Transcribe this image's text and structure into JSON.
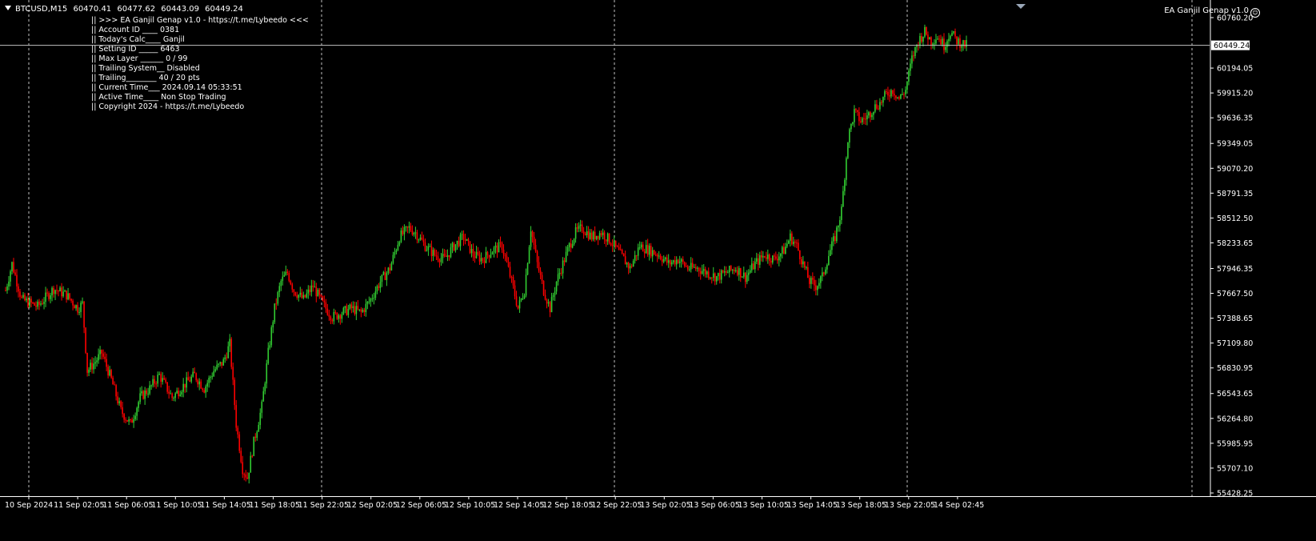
{
  "header": {
    "symbol": "BTCUSD,M15",
    "open": "60470.41",
    "high": "60477.62",
    "low": "60443.09",
    "close": "60449.24"
  },
  "ea_panel": {
    "lines": [
      "|| >>> EA Ganjil Genap v1.0 - https://t.me/Lybeedo <<<",
      "|| Account ID ____ 0381",
      "|| Today's Calc____ Ganjil",
      "|| Setting ID _____ 6463",
      "|| Max Layer ______ 0 / 99",
      "|| Trailing System__ Disabled",
      "|| Trailing________ 40 / 20 pts",
      "|| Current Time___ 2024.09.14 05:33:51",
      "|| Active Time____ Non Stop Trading",
      "|| Copyright 2024 - https://t.me/Lybeedo"
    ]
  },
  "ea_title": "EA Ganjil Genap v1.0",
  "colors": {
    "background": "#000000",
    "bull": "#32CD32",
    "bear": "#FF0000",
    "grid": "#C0C0C0",
    "price_line": "#C0C0C0"
  },
  "chart_data": {
    "type": "candlestick",
    "current_price": "60449.24",
    "y_ticks": [
      "60760.20",
      "60194.05",
      "59915.20",
      "59636.35",
      "59349.05",
      "59070.20",
      "58791.35",
      "58512.50",
      "58233.65",
      "57946.35",
      "57667.50",
      "57388.65",
      "57109.80",
      "56830.95",
      "56543.65",
      "56264.80",
      "55985.95",
      "55707.10",
      "55428.25"
    ],
    "ylim": [
      55428.25,
      60760.2
    ],
    "x_ticks": [
      "10 Sep 2024",
      "11 Sep 02:05",
      "11 Sep 06:05",
      "11 Sep 10:05",
      "11 Sep 14:05",
      "11 Sep 18:05",
      "11 Sep 22:05",
      "12 Sep 02:05",
      "12 Sep 06:05",
      "12 Sep 10:05",
      "12 Sep 14:05",
      "12 Sep 18:05",
      "12 Sep 22:05",
      "13 Sep 02:05",
      "13 Sep 06:05",
      "13 Sep 10:05",
      "13 Sep 14:05",
      "13 Sep 18:05",
      "13 Sep 22:05",
      "14 Sep 02:45"
    ],
    "day_separators": [
      "11 Sep",
      "12 Sep",
      "13 Sep",
      "14 Sep"
    ],
    "keypoints": [
      [
        0,
        57700
      ],
      [
        4,
        58000
      ],
      [
        10,
        57600
      ],
      [
        20,
        57520
      ],
      [
        30,
        57720
      ],
      [
        38,
        57650
      ],
      [
        45,
        57500
      ],
      [
        48,
        57550
      ],
      [
        51,
        56800
      ],
      [
        56,
        56900
      ],
      [
        60,
        57000
      ],
      [
        66,
        56700
      ],
      [
        72,
        56350
      ],
      [
        78,
        56200
      ],
      [
        84,
        56500
      ],
      [
        90,
        56600
      ],
      [
        96,
        56750
      ],
      [
        104,
        56500
      ],
      [
        112,
        56650
      ],
      [
        118,
        56750
      ],
      [
        124,
        56600
      ],
      [
        130,
        56800
      ],
      [
        136,
        56900
      ],
      [
        140,
        57100
      ],
      [
        144,
        56200
      ],
      [
        148,
        55700
      ],
      [
        151,
        55600
      ],
      [
        155,
        56000
      ],
      [
        160,
        56400
      ],
      [
        164,
        57000
      ],
      [
        168,
        57500
      ],
      [
        172,
        57800
      ],
      [
        176,
        57900
      ],
      [
        180,
        57700
      ],
      [
        186,
        57600
      ],
      [
        192,
        57750
      ],
      [
        198,
        57550
      ],
      [
        204,
        57400
      ],
      [
        210,
        57450
      ],
      [
        216,
        57500
      ],
      [
        222,
        57450
      ],
      [
        228,
        57600
      ],
      [
        234,
        57800
      ],
      [
        240,
        57950
      ],
      [
        246,
        58300
      ],
      [
        252,
        58400
      ],
      [
        256,
        58350
      ],
      [
        262,
        58200
      ],
      [
        268,
        58100
      ],
      [
        274,
        58050
      ],
      [
        280,
        58200
      ],
      [
        286,
        58300
      ],
      [
        292,
        58100
      ],
      [
        298,
        58050
      ],
      [
        304,
        58150
      ],
      [
        310,
        58200
      ],
      [
        316,
        57800
      ],
      [
        320,
        57500
      ],
      [
        324,
        57700
      ],
      [
        328,
        58400
      ],
      [
        332,
        58000
      ],
      [
        336,
        57700
      ],
      [
        340,
        57500
      ],
      [
        344,
        57800
      ],
      [
        348,
        58000
      ],
      [
        352,
        58200
      ],
      [
        356,
        58350
      ],
      [
        360,
        58400
      ],
      [
        366,
        58300
      ],
      [
        372,
        58350
      ],
      [
        378,
        58250
      ],
      [
        384,
        58100
      ],
      [
        390,
        57950
      ],
      [
        396,
        58200
      ],
      [
        402,
        58150
      ],
      [
        408,
        58100
      ],
      [
        414,
        58000
      ],
      [
        420,
        58050
      ],
      [
        426,
        57950
      ],
      [
        432,
        57950
      ],
      [
        438,
        57900
      ],
      [
        444,
        57850
      ],
      [
        450,
        57900
      ],
      [
        456,
        57950
      ],
      [
        462,
        57850
      ],
      [
        468,
        58000
      ],
      [
        474,
        58100
      ],
      [
        480,
        58050
      ],
      [
        486,
        58150
      ],
      [
        490,
        58300
      ],
      [
        494,
        58200
      ],
      [
        498,
        58000
      ],
      [
        502,
        57800
      ],
      [
        506,
        57750
      ],
      [
        510,
        57850
      ],
      [
        514,
        58100
      ],
      [
        518,
        58300
      ],
      [
        522,
        58600
      ],
      [
        526,
        59400
      ],
      [
        530,
        59700
      ],
      [
        534,
        59600
      ],
      [
        538,
        59650
      ],
      [
        542,
        59750
      ],
      [
        546,
        59800
      ],
      [
        550,
        59900
      ],
      [
        554,
        59950
      ],
      [
        558,
        59850
      ],
      [
        562,
        59950
      ],
      [
        566,
        60300
      ],
      [
        570,
        60500
      ],
      [
        574,
        60600
      ],
      [
        578,
        60500
      ],
      [
        582,
        60550
      ],
      [
        586,
        60450
      ],
      [
        590,
        60600
      ],
      [
        594,
        60500
      ],
      [
        600,
        60450
      ]
    ]
  }
}
